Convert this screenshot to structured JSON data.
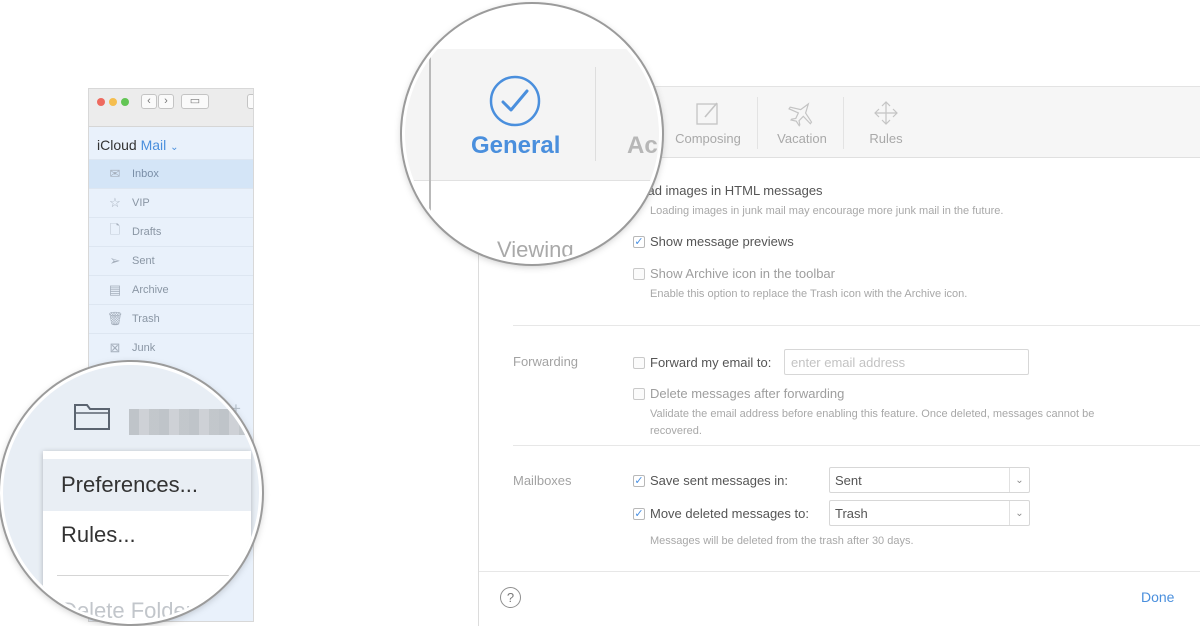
{
  "sidebar": {
    "app_name": "iCloud",
    "app_menu": "Mail",
    "app_chevron": "⌄",
    "mailboxes": [
      {
        "label": "Inbox",
        "icon": "inbox-icon",
        "glyph": "✉"
      },
      {
        "label": "VIP",
        "icon": "star-icon",
        "glyph": "☆"
      },
      {
        "label": "Drafts",
        "icon": "document-icon",
        "glyph": "🗋"
      },
      {
        "label": "Sent",
        "icon": "paper-plane-icon",
        "glyph": "➢"
      },
      {
        "label": "Archive",
        "icon": "archive-box-icon",
        "glyph": "▤"
      },
      {
        "label": "Trash",
        "icon": "trash-icon",
        "glyph": "🗑"
      },
      {
        "label": "Junk",
        "icon": "junk-icon",
        "glyph": "⊠"
      }
    ],
    "plus": "+",
    "refresh": "↻"
  },
  "toolbar": {
    "back": "‹",
    "forward": "›",
    "sidebar_toggle": "▭"
  },
  "context_menu": {
    "items": [
      "Preferences...",
      "Rules...",
      "Delete Folder"
    ]
  },
  "preferences": {
    "tabs": [
      {
        "label": "General",
        "icon": "checkmark-circle-icon",
        "selected": true
      },
      {
        "label": "Ac",
        "icon": "accounts-icon"
      },
      {
        "label": "Composing",
        "icon": "compose-icon"
      },
      {
        "label": "Vacation",
        "icon": "airplane-icon"
      },
      {
        "label": "Rules",
        "icon": "arrows-icon"
      }
    ],
    "viewing_heading": "Viewing",
    "viewing": {
      "load_images": "Load images in HTML messages",
      "load_images_hint": "Loading images in junk mail may encourage more junk mail in the future.",
      "show_previews": "Show message previews",
      "show_archive": "Show Archive icon in the toolbar",
      "show_archive_hint": "Enable this option to replace the Trash icon with the Archive icon."
    },
    "forwarding": {
      "section": "Forwarding",
      "forward_label": "Forward my email to:",
      "email_placeholder": "enter email address",
      "delete_after": "Delete messages after forwarding",
      "hint_line1": "Validate the email address before enabling this feature. Once deleted, messages cannot be",
      "hint_line2": "recovered."
    },
    "mailboxes": {
      "section": "Mailboxes",
      "save_sent": "Save sent messages in:",
      "save_sent_value": "Sent",
      "move_deleted": "Move deleted messages to:",
      "move_deleted_value": "Trash",
      "hint": "Messages will be deleted from the trash after 30 days."
    },
    "help": "?",
    "done": "Done",
    "checkmark": "✓",
    "chevron": "⌄"
  },
  "colors": {
    "accent": "#4a8fdd",
    "sidebar_bg": "#e9f1fb",
    "selected_row": "#d4e5f7"
  }
}
